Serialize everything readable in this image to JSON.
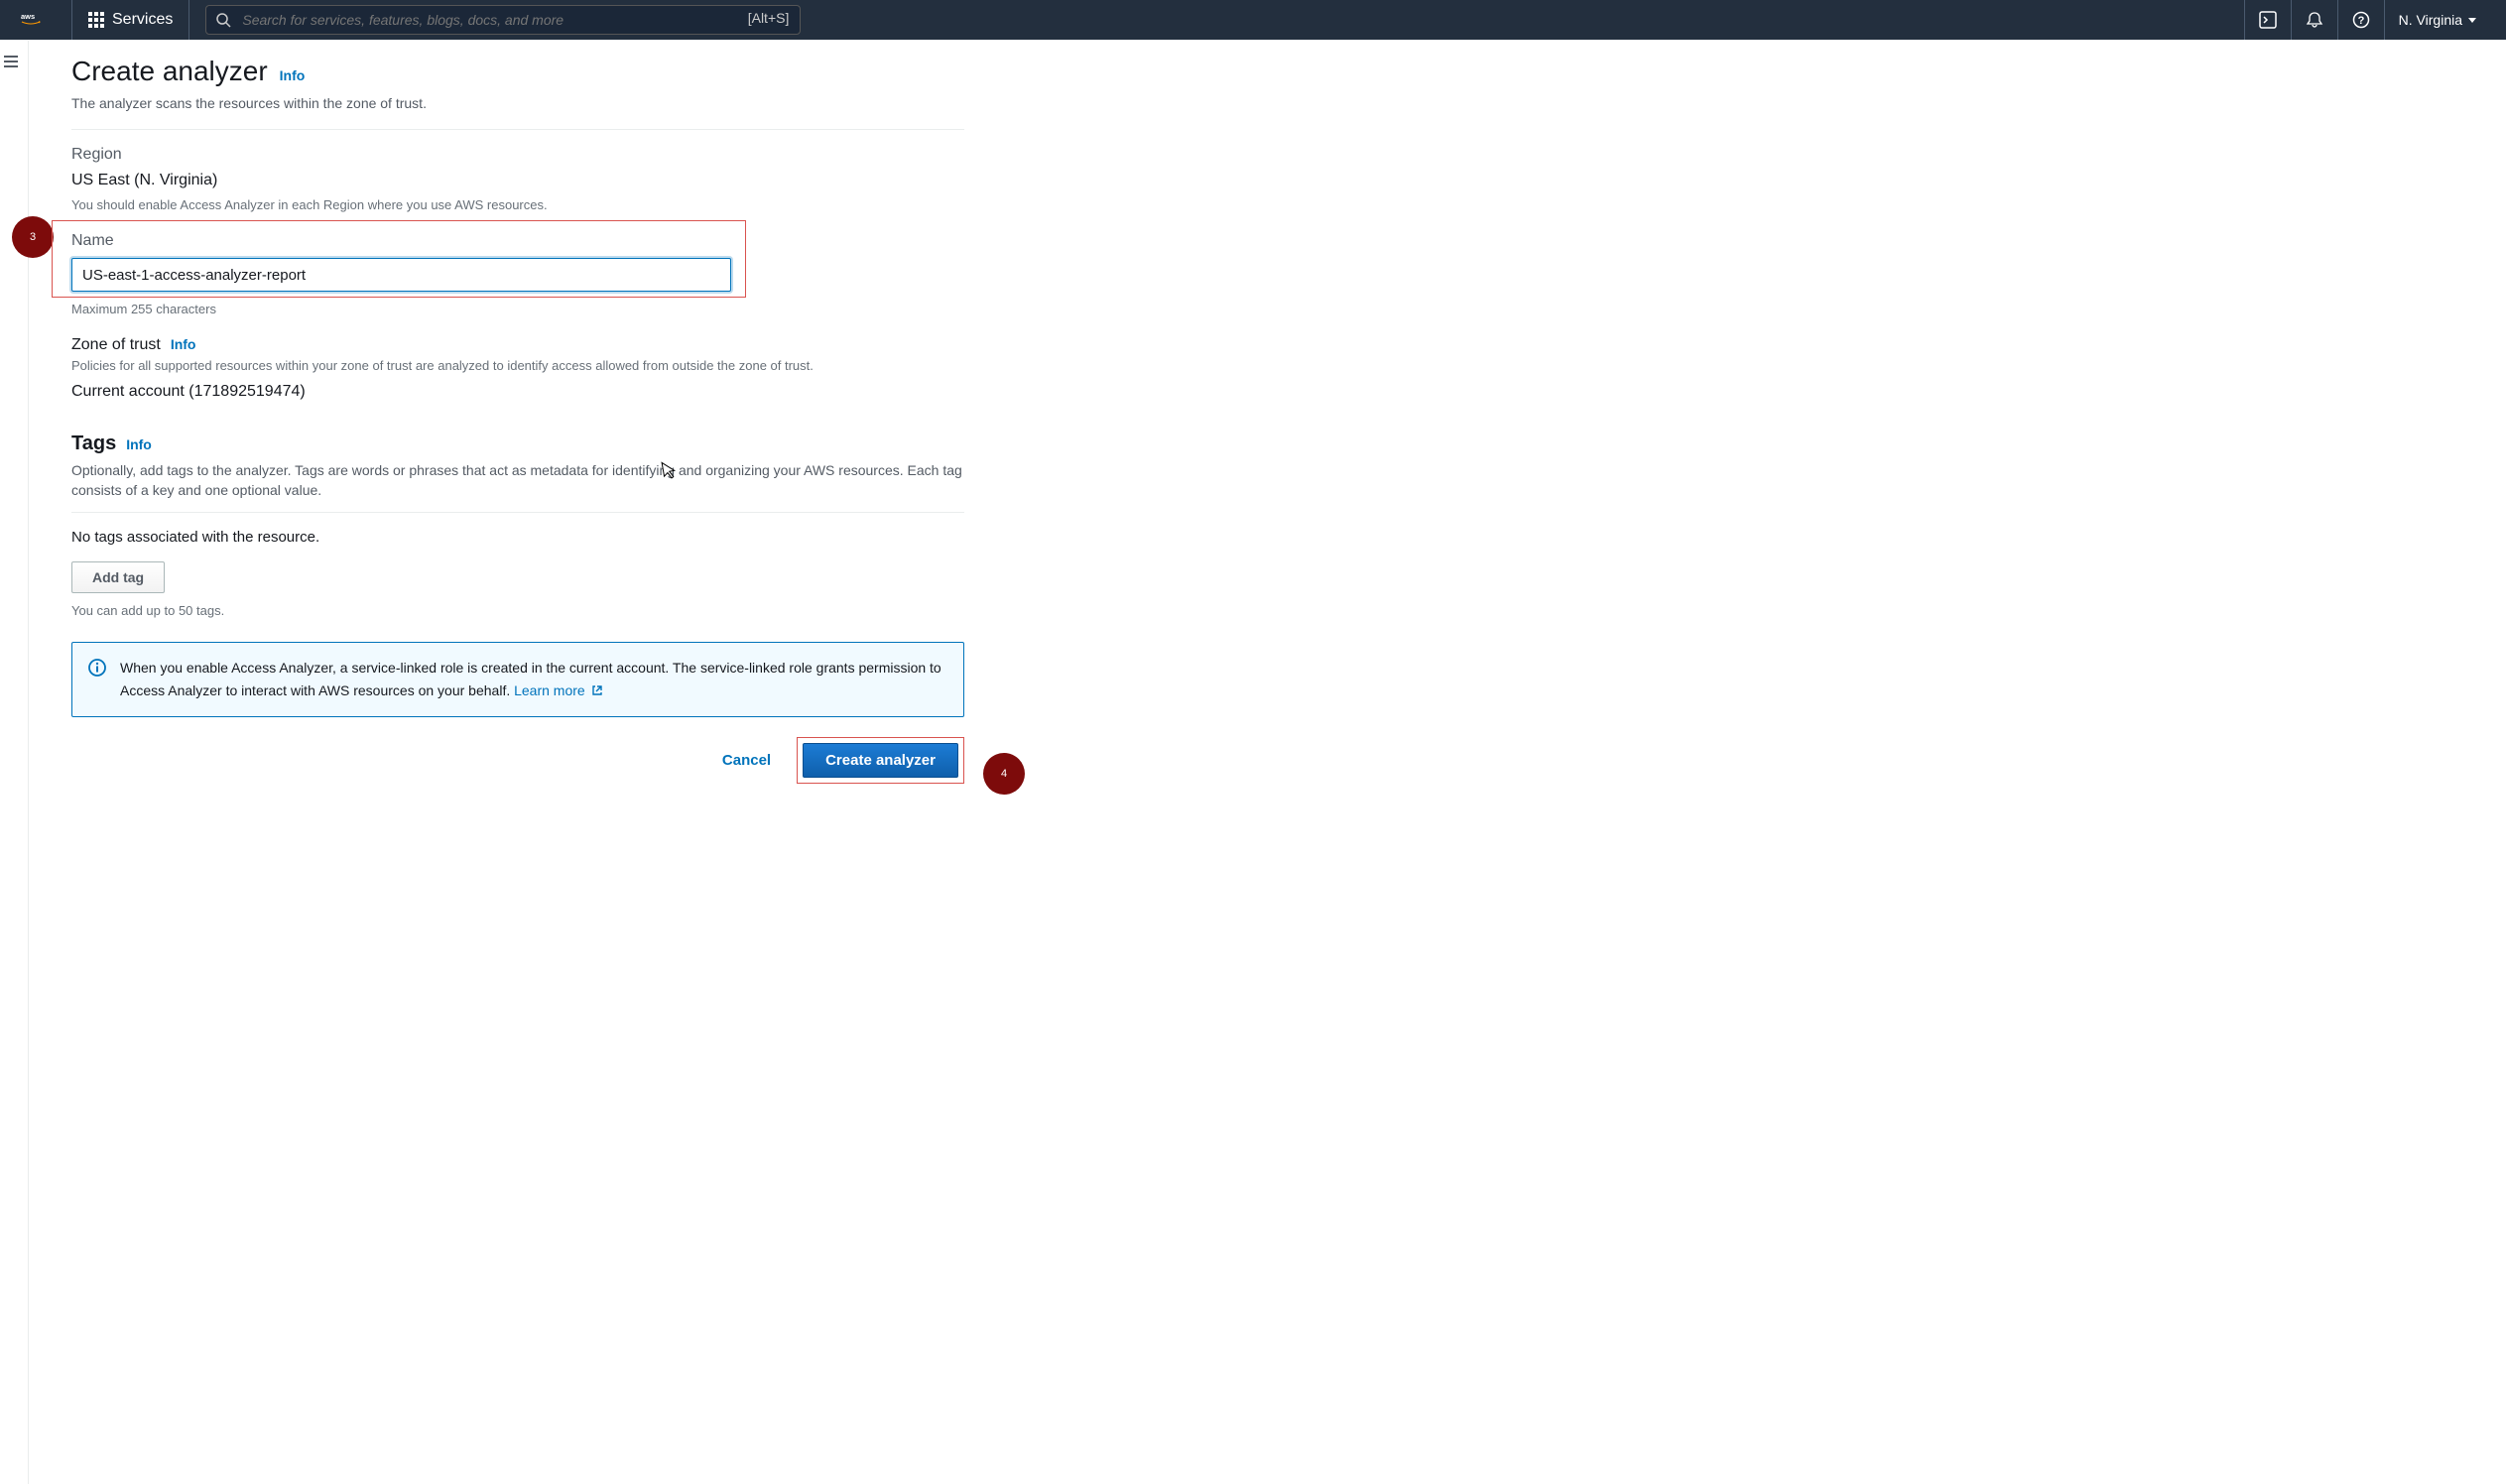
{
  "header": {
    "services_label": "Services",
    "search_placeholder": "Search for services, features, blogs, docs, and more",
    "search_shortcut": "[Alt+S]",
    "region": "N. Virginia"
  },
  "page": {
    "title": "Create analyzer",
    "title_info": "Info",
    "subtitle": "The analyzer scans the resources within the zone of trust."
  },
  "region_section": {
    "label": "Region",
    "value": "US East (N. Virginia)",
    "hint": "You should enable Access Analyzer in each Region where you use AWS resources."
  },
  "name_section": {
    "label": "Name",
    "value": "US-east-1-access-analyzer-report",
    "hint": "Maximum 255 characters"
  },
  "zone_section": {
    "label": "Zone of trust",
    "info": "Info",
    "desc": "Policies for all supported resources within your zone of trust are analyzed to identify access allowed from outside the zone of trust.",
    "value": "Current account (171892519474)"
  },
  "tags_section": {
    "heading": "Tags",
    "info": "Info",
    "desc": "Optionally, add tags to the analyzer. Tags are words or phrases that act as metadata for identifying and organizing your AWS resources. Each tag consists of a key and one optional value.",
    "empty_text": "No tags associated with the resource.",
    "add_button": "Add tag",
    "limit_text": "You can add up to 50 tags."
  },
  "info_box": {
    "text": "When you enable Access Analyzer, a service-linked role is created in the current account. The service-linked role grants permission to Access Analyzer to interact with AWS resources on your behalf. ",
    "learn_more": "Learn more"
  },
  "actions": {
    "cancel": "Cancel",
    "create": "Create analyzer"
  },
  "callouts": {
    "badge3": "3",
    "badge4": "4"
  }
}
